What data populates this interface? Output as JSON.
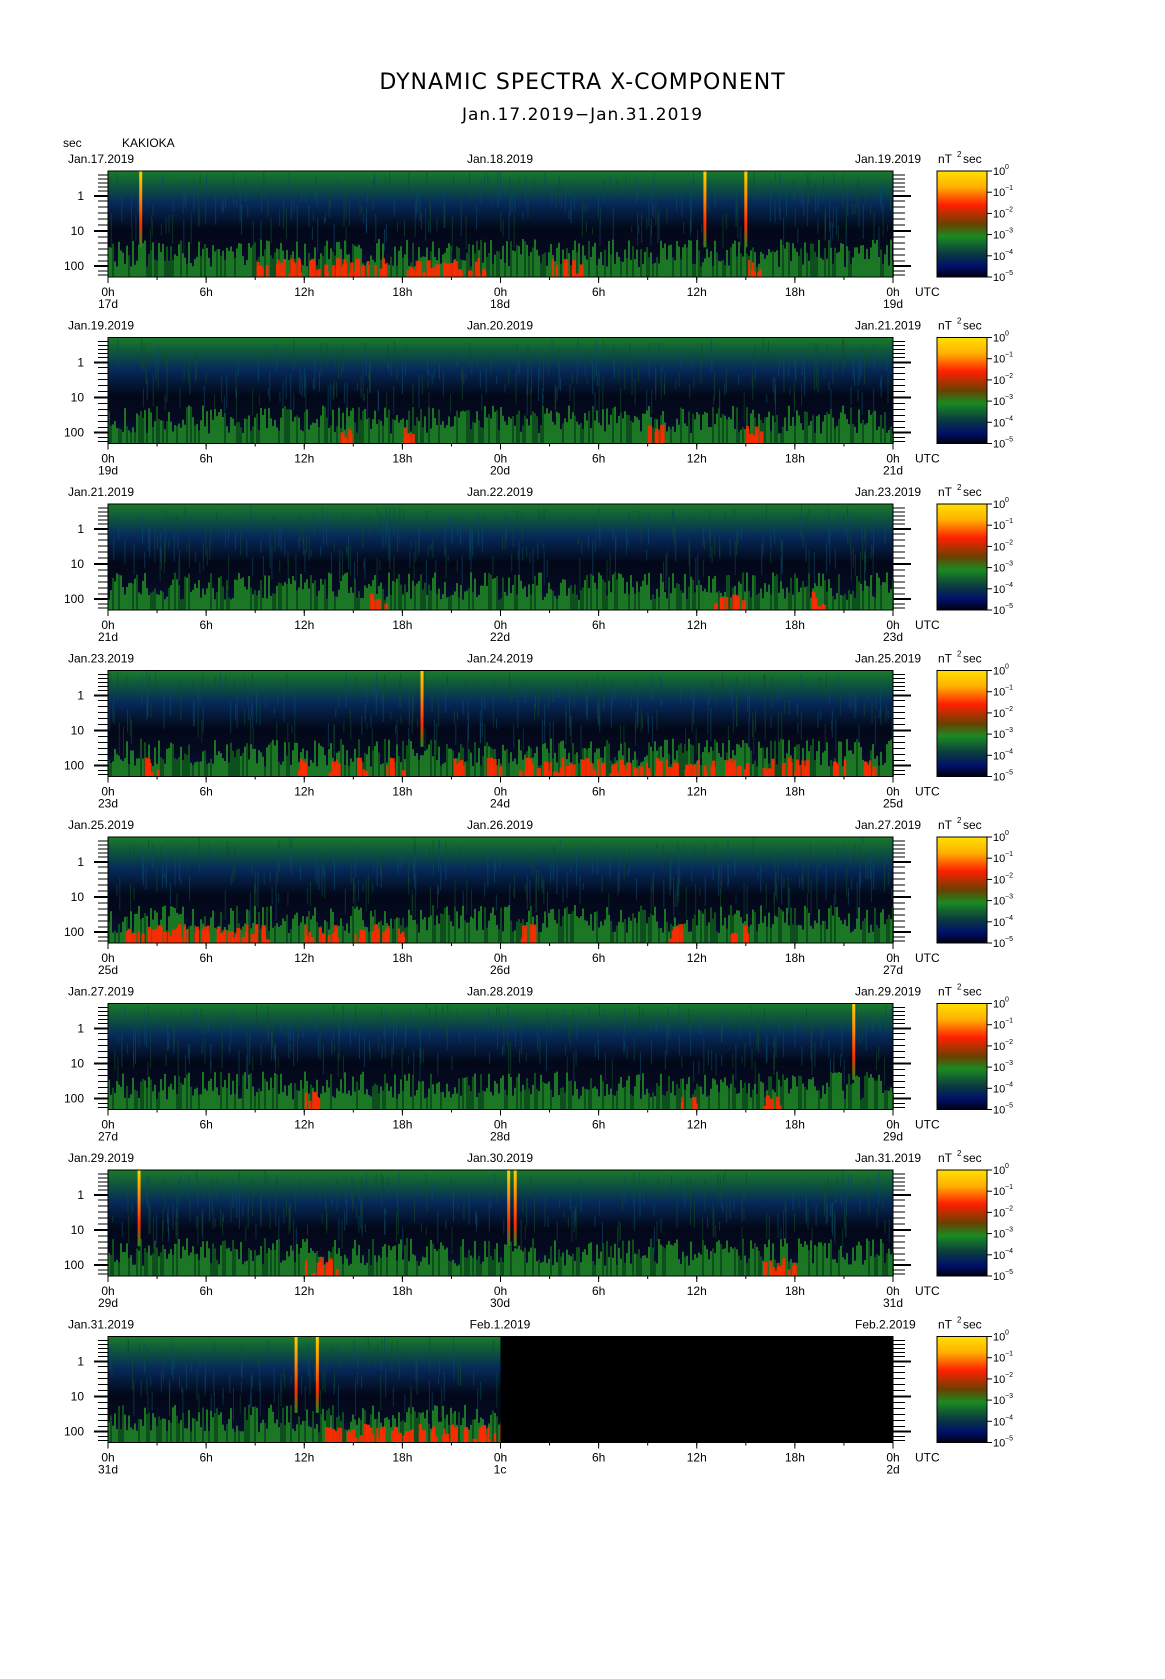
{
  "title": "DYNAMIC SPECTRA X-COMPONENT",
  "subtitle": "Jan.17.2019−Jan.31.2019",
  "y_unit": "sec",
  "station": "KAKIOKA",
  "colorbar_unit_label": "nT",
  "colorbar_unit_exp": "2",
  "colorbar_unit_suffix": "sec",
  "colorbar_ticks": [
    "10",
    "10",
    "10",
    "10",
    "10",
    "10"
  ],
  "colorbar_exps": [
    "0",
    "−1",
    "−2",
    "−3",
    "−4",
    "−5"
  ],
  "y_ticks": [
    "1",
    "10",
    "100"
  ],
  "x_ticks": [
    "0h",
    "6h",
    "12h",
    "18h",
    "0h",
    "6h",
    "12h",
    "18h",
    "0h"
  ],
  "utc_label": "UTC",
  "colors": {
    "low": "#0a0a14",
    "mid": "#00208a",
    "green": "#1e8a22",
    "red": "#ff2a00",
    "yellow": "#ffd200"
  },
  "chart_data": [
    {
      "type": "heatmap",
      "date_left": "Jan.17.2019",
      "date_mid": "Jan.18.2019",
      "date_right": "Jan.19.2019",
      "day_start": "17d",
      "day_mid": "18d",
      "day_end": "19d",
      "spikes_h": [
        2,
        36.5,
        39
      ],
      "red_hours": [
        9,
        10,
        11,
        12,
        13,
        14,
        15,
        16,
        18,
        19,
        20,
        21,
        22,
        27,
        28,
        39
      ]
    },
    {
      "type": "heatmap",
      "date_left": "Jan.19.2019",
      "date_mid": "Jan.20.2019",
      "date_right": "Jan.21.2019",
      "day_start": "19d",
      "day_mid": "20d",
      "day_end": "21d",
      "spikes_h": [],
      "red_hours": [
        14,
        18,
        33,
        39
      ]
    },
    {
      "type": "heatmap",
      "date_left": "Jan.21.2019",
      "date_mid": "Jan.22.2019",
      "date_right": "Jan.23.2019",
      "day_start": "21d",
      "day_mid": "22d",
      "day_end": "23d",
      "spikes_h": [],
      "red_hours": [
        16,
        37,
        38,
        43
      ]
    },
    {
      "type": "heatmap",
      "date_left": "Jan.23.2019",
      "date_mid": "Jan.24.2019",
      "date_right": "Jan.25.2019",
      "day_start": "23d",
      "day_mid": "24d",
      "day_end": "25d",
      "spikes_h": [
        19.2
      ],
      "red_hours": [
        2,
        11,
        13,
        15,
        17,
        21,
        23,
        25,
        26,
        27,
        28,
        29,
        30,
        31,
        32,
        33,
        34,
        35,
        36,
        37,
        38,
        40,
        41,
        42,
        44,
        46
      ]
    },
    {
      "type": "heatmap",
      "date_left": "Jan.25.2019",
      "date_mid": "Jan.26.2019",
      "date_right": "Jan.27.2019",
      "day_start": "25d",
      "day_mid": "26d",
      "day_end": "27d",
      "spikes_h": [],
      "red_hours": [
        1,
        2,
        3,
        4,
        5,
        6,
        7,
        8,
        9,
        12,
        13,
        15,
        16,
        17,
        25,
        34,
        38
      ]
    },
    {
      "type": "heatmap",
      "date_left": "Jan.27.2019",
      "date_mid": "Jan.28.2019",
      "date_right": "Jan.29.2019",
      "day_start": "27d",
      "day_mid": "28d",
      "day_end": "29d",
      "spikes_h": [
        45.6
      ],
      "red_hours": [
        12,
        35,
        40
      ]
    },
    {
      "type": "heatmap",
      "date_left": "Jan.29.2019",
      "date_mid": "Jan.30.2019",
      "date_right": "Jan.31.2019",
      "day_start": "29d",
      "day_mid": "30d",
      "day_end": "31d",
      "spikes_h": [
        1.9,
        24.5,
        24.9
      ],
      "red_hours": [
        12,
        13,
        40,
        41
      ]
    },
    {
      "type": "heatmap",
      "date_left": "Jan.31.2019",
      "date_mid": "Feb.1.2019",
      "date_right": "Feb.2.2019",
      "day_start": "31d",
      "day_mid": "1c",
      "day_end": "2d",
      "spikes_h": [
        11.5,
        12.8
      ],
      "red_hours": [
        13,
        14,
        15,
        16,
        17,
        18,
        19,
        20,
        21,
        22,
        23
      ],
      "data_end_h": 24
    }
  ]
}
